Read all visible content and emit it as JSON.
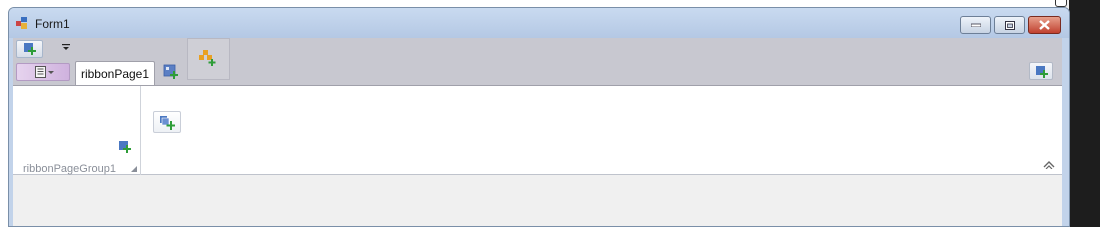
{
  "window": {
    "title": "Form1",
    "buttons": {
      "minimize": "minimize",
      "maximize": "maximize",
      "close": "close"
    }
  },
  "ribbon": {
    "tab_label": "ribbonPage1",
    "group_label": "ribbonPageGroup1"
  },
  "icons": {
    "app": "app-icon",
    "add": "add-item-icon",
    "dropdown": "chevron-down-icon",
    "add_group": "add-group-icon",
    "collapse": "collapse-ribbon-icon"
  },
  "colors": {
    "titlebar": "#b4c8e4",
    "ribbon_bg": "#c8c8d0",
    "close_button": "#c04130",
    "add_icon_blue": "#4a78c2",
    "add_icon_green": "#2e9d38",
    "add_group_orange": "#e9a022"
  }
}
